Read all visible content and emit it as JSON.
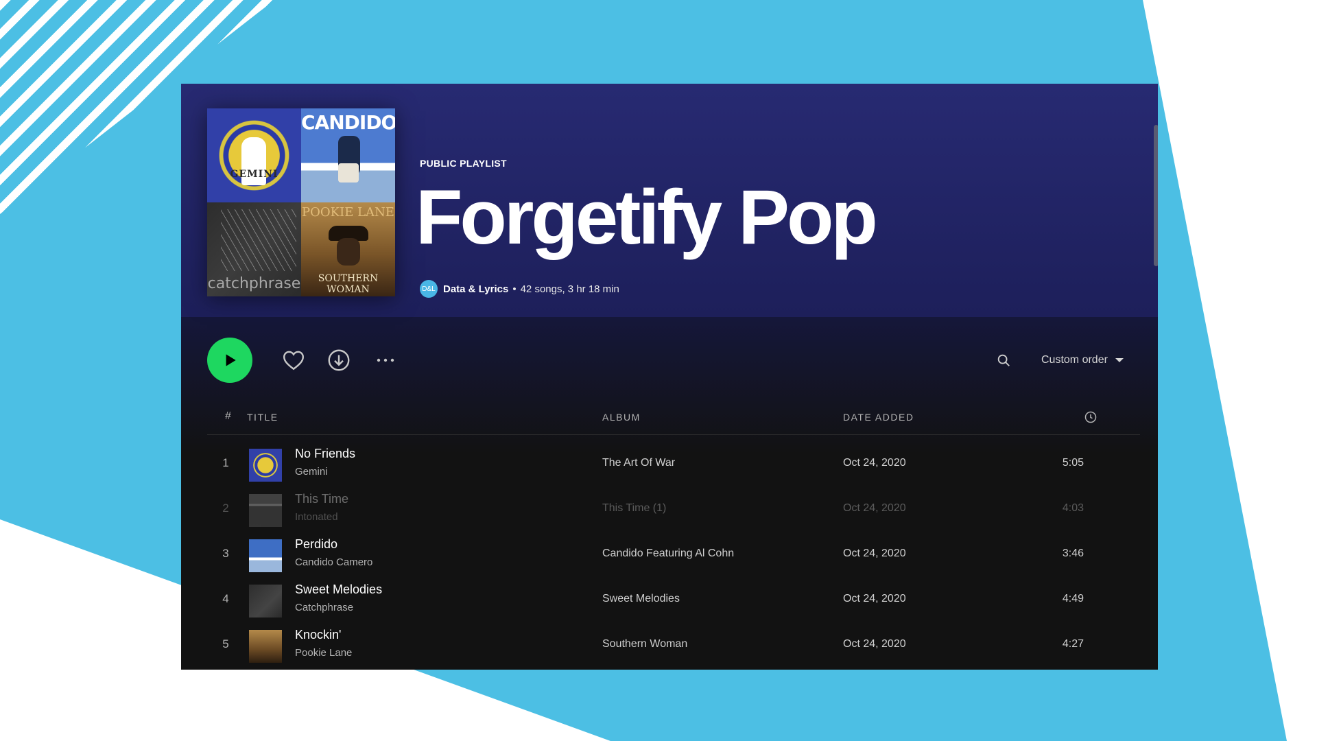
{
  "playlist": {
    "type_label": "PUBLIC PLAYLIST",
    "title": "Forgetify Pop",
    "owner_avatar_text": "D&L",
    "owner": "Data & Lyrics",
    "separator": "•",
    "stats": "42 songs, 3 hr 18 min",
    "cover_labels": [
      "GEMINI",
      "CANDIDO",
      "catchphrase",
      "SOUTHERN WOMAN",
      "POOKIE LANE"
    ]
  },
  "controls": {
    "play_icon": "play-icon",
    "like_icon": "heart-icon",
    "download_icon": "download-icon",
    "more_icon": "more-horizontal-icon",
    "search_icon": "search-icon",
    "sort_label": "Custom order",
    "sort_icon": "caret-down-icon"
  },
  "table": {
    "headers": {
      "num": "#",
      "title": "TITLE",
      "album": "ALBUM",
      "date_added": "DATE ADDED",
      "duration_icon": "clock-icon"
    },
    "rows": [
      {
        "num": "1",
        "title": "No Friends",
        "artist": "Gemini",
        "album": "The Art Of War",
        "date_added": "Oct 24, 2020",
        "duration": "5:05",
        "unavailable": false
      },
      {
        "num": "2",
        "title": "This Time",
        "artist": "Intonated",
        "album": "This Time (1)",
        "date_added": "Oct 24, 2020",
        "duration": "4:03",
        "unavailable": true
      },
      {
        "num": "3",
        "title": "Perdido",
        "artist": "Candido Camero",
        "album": "Candido Featuring Al Cohn",
        "date_added": "Oct 24, 2020",
        "duration": "3:46",
        "unavailable": false
      },
      {
        "num": "4",
        "title": "Sweet Melodies",
        "artist": "Catchphrase",
        "album": "Sweet Melodies",
        "date_added": "Oct 24, 2020",
        "duration": "4:49",
        "unavailable": false
      },
      {
        "num": "5",
        "title": "Knockin'",
        "artist": "Pookie Lane",
        "album": "Southern Woman",
        "date_added": "Oct 24, 2020",
        "duration": "4:27",
        "unavailable": false
      }
    ]
  },
  "colors": {
    "accent_green": "#1ed760",
    "hero_gradient_top": "#272a72",
    "background_blue": "#4cbfe4",
    "window_bg": "#121212"
  }
}
